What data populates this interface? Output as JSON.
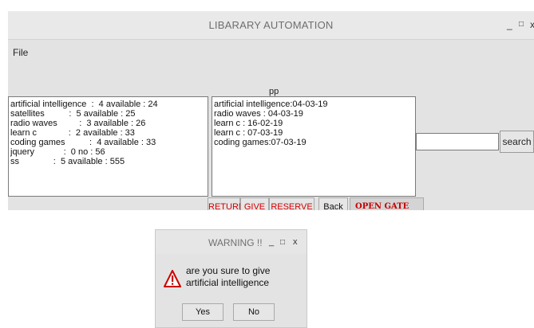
{
  "window": {
    "title": "LIBARARY AUTOMATION",
    "controls": {
      "minimize": "_",
      "maximize": "□",
      "close": "x"
    }
  },
  "menubar": {
    "file": "File"
  },
  "middle_label": "pp",
  "books_list": [
    "artificial intelligence  :  4 available : 24",
    "satellites          :  5 available : 25",
    "radio waves         :  3 available : 26",
    "learn c             :  2 available : 33",
    "coding games          :  4 available : 33",
    "jquery            :  0 no : 56",
    "ss              :  5 available : 555"
  ],
  "issue_list": [
    "artificial intelligence:04-03-19",
    "radio waves : 04-03-19",
    "learn c : 16-02-19",
    "learn c : 07-03-19",
    "coding games:07-03-19"
  ],
  "search": {
    "value": "",
    "button_label": "search"
  },
  "buttons": {
    "return": "RETURN",
    "give": "GIVE",
    "reserve": "RESERVE",
    "back": "Back",
    "open_gate": "OPEN GATE"
  },
  "colors": {
    "action_text": "#d10000",
    "warning_icon": "#cc0000"
  },
  "dialog": {
    "title": "WARNING !!",
    "controls": {
      "minimize": "_",
      "maximize": "□",
      "close": "x"
    },
    "icon": "warning-icon",
    "message": "are you sure to give artificial intelligence",
    "yes_label": "Yes",
    "no_label": "No"
  }
}
